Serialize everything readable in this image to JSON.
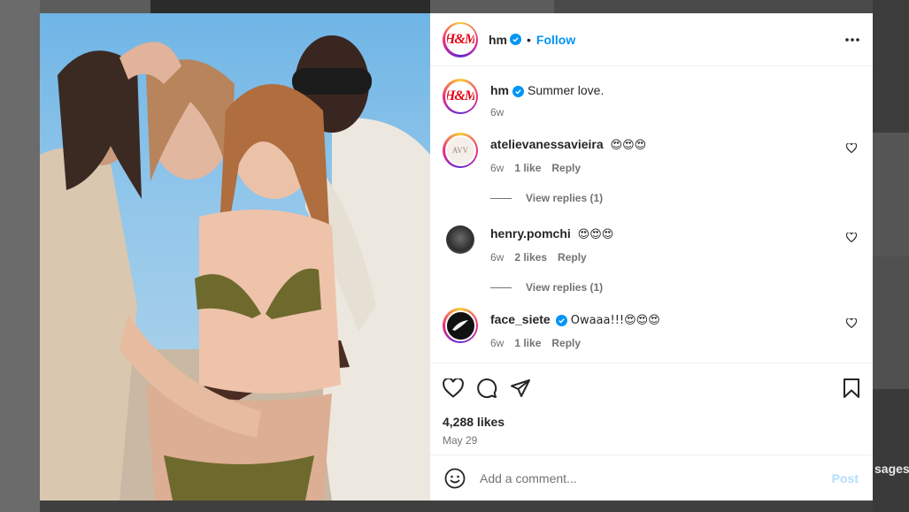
{
  "post": {
    "author": "hm",
    "follow_label": "Follow",
    "separator": "•",
    "caption": "Summer love.",
    "caption_age": "6w",
    "likes": "4,288 likes",
    "date": "May 29"
  },
  "comments": [
    {
      "username": "atelievanessavieira",
      "text": "😍😍😍",
      "age": "6w",
      "likes": "1 like",
      "reply": "Reply",
      "verified": false,
      "avatar_text": "AVV"
    },
    {
      "username": "henry.pomchi",
      "text": "😍😍😍",
      "age": "6w",
      "likes": "2 likes",
      "reply": "Reply",
      "verified": false
    },
    {
      "username": "face_siete",
      "text": "Owaaa!!!😍😍😍",
      "age": "6w",
      "likes": "1 like",
      "reply": "Reply",
      "verified": true
    }
  ],
  "view_replies": [
    "View replies (1)",
    "View replies (1)"
  ],
  "add_comment": {
    "placeholder": "Add a comment...",
    "post_label": "Post"
  },
  "background": {
    "partial_text": "sages"
  },
  "logo_text": "H&M",
  "icons": {
    "more": "more-horizontal-icon",
    "like": "heart-icon",
    "comment": "comment-bubble-icon",
    "share": "paper-plane-icon",
    "save": "bookmark-icon",
    "emoji": "smiley-icon",
    "verified": "verified-badge-icon"
  },
  "colors": {
    "accent": "#0095f6",
    "brand": "#e50010",
    "muted": "#737373",
    "post_disabled": "#b2dffc"
  }
}
